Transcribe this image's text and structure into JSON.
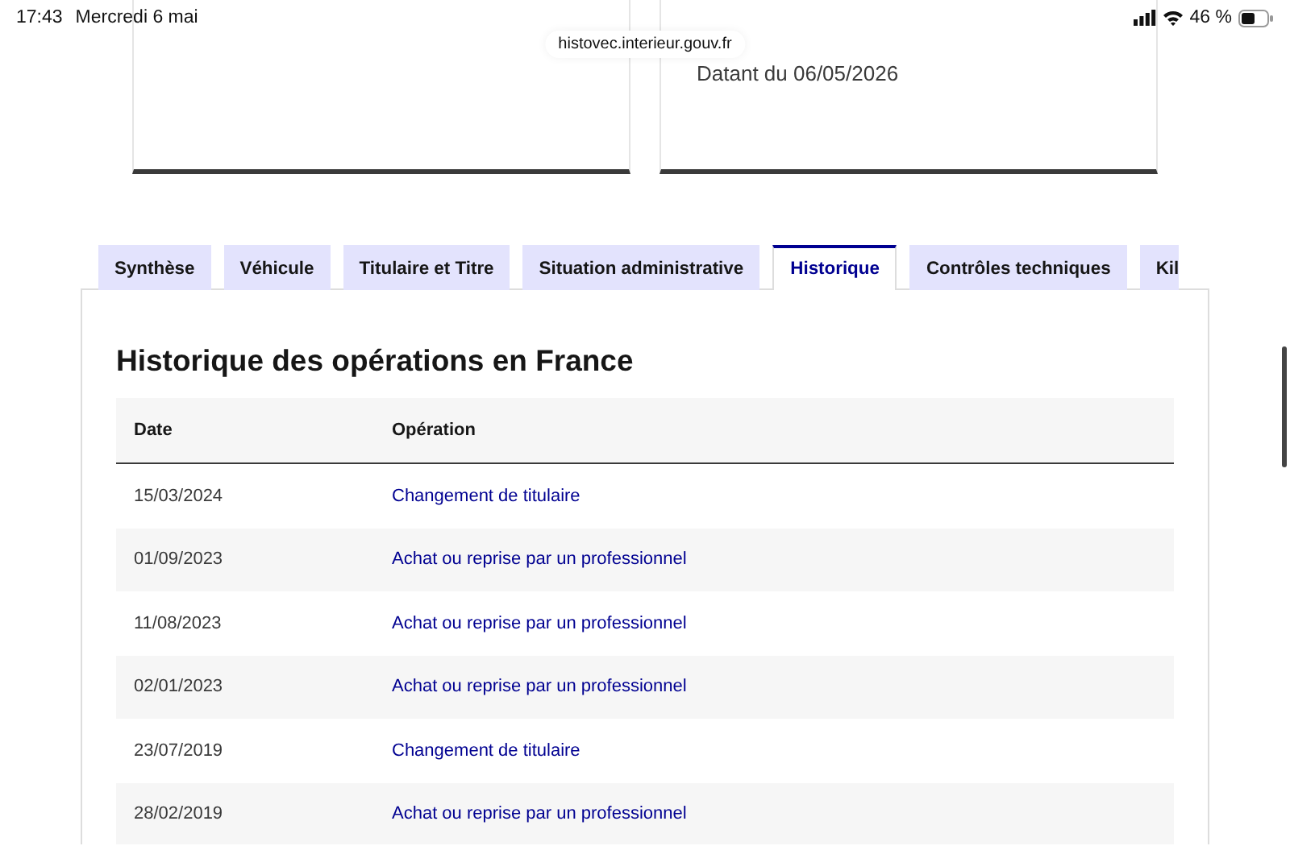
{
  "status_bar": {
    "time": "17:43",
    "date": "Mercredi 6 mai",
    "battery": "46 %"
  },
  "address_bar": {
    "url": "histovec.interieur.gouv.fr"
  },
  "cards": [
    {
      "kind": "empty"
    },
    {
      "kind": "text",
      "text": "Datant du 06/05/2026"
    }
  ],
  "tabs": [
    {
      "label": "Synthèse",
      "selected": false
    },
    {
      "label": "Véhicule",
      "selected": false
    },
    {
      "label": "Titulaire et Titre",
      "selected": false
    },
    {
      "label": "Situation administrative",
      "selected": false
    },
    {
      "label": "Historique",
      "selected": true
    },
    {
      "label": "Contrôles techniques",
      "selected": false
    },
    {
      "label": "Kil",
      "selected": false
    }
  ],
  "section": {
    "title": "Historique des opérations en France"
  },
  "table": {
    "columns": [
      "Date",
      "Opération"
    ],
    "rows": [
      {
        "date": "15/03/2024",
        "operation": "Changement de titulaire"
      },
      {
        "date": "01/09/2023",
        "operation": "Achat ou reprise par un professionnel"
      },
      {
        "date": "11/08/2023",
        "operation": "Achat ou reprise par un professionnel"
      },
      {
        "date": "02/01/2023",
        "operation": "Achat ou reprise par un professionnel"
      },
      {
        "date": "23/07/2019",
        "operation": "Changement de titulaire"
      },
      {
        "date": "28/02/2019",
        "operation": "Achat ou reprise par un professionnel"
      }
    ]
  }
}
